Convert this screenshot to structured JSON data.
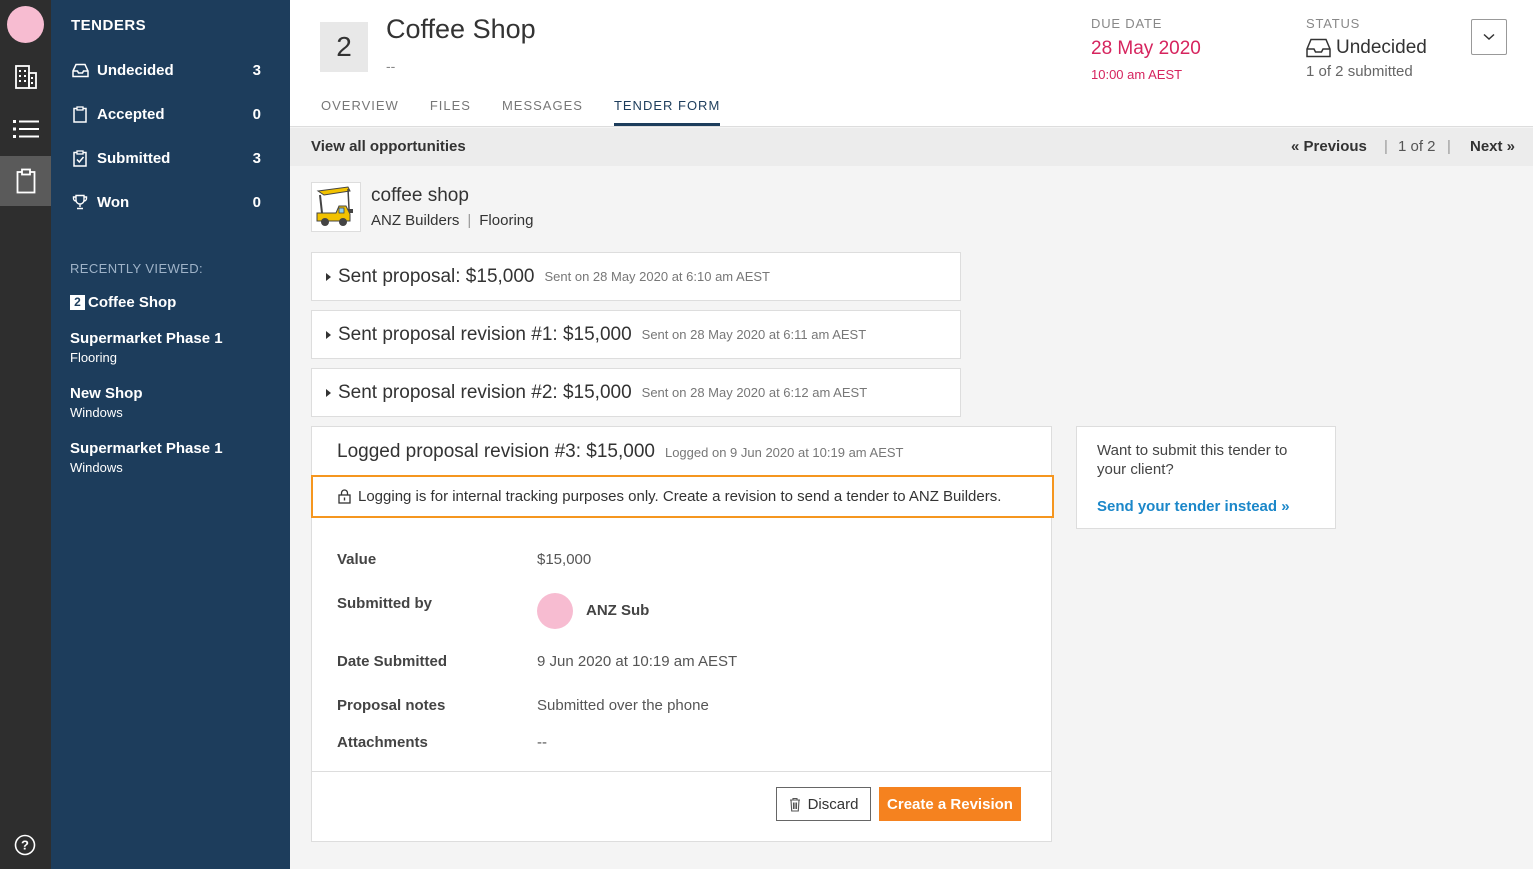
{
  "rail": {
    "icons": [
      "building-icon",
      "list-icon",
      "clipboard-icon",
      "help-icon"
    ]
  },
  "sidebar": {
    "heading": "TENDERS",
    "items": [
      {
        "label": "Undecided",
        "count": "3",
        "icon": "inbox-icon"
      },
      {
        "label": "Accepted",
        "count": "0",
        "icon": "clipboard-icon"
      },
      {
        "label": "Submitted",
        "count": "3",
        "icon": "clipboard-check-icon"
      },
      {
        "label": "Won",
        "count": "0",
        "icon": "trophy-icon"
      }
    ],
    "recent_heading": "RECENTLY VIEWED:",
    "recent": [
      {
        "badge": "2",
        "title": "Coffee Shop",
        "sub": ""
      },
      {
        "title": "Supermarket Phase 1",
        "sub": "Flooring"
      },
      {
        "title": "New Shop",
        "sub": "Windows"
      },
      {
        "title": "Supermarket Phase 1",
        "sub": "Windows"
      }
    ]
  },
  "header": {
    "number": "2",
    "title": "Coffee Shop",
    "subtitle": "--",
    "tabs": [
      "OVERVIEW",
      "FILES",
      "MESSAGES",
      "TENDER FORM"
    ],
    "active_tab": "TENDER FORM",
    "due_label": "DUE DATE",
    "due_date": "28 May 2020",
    "due_time": "10:00 am AEST",
    "status_label": "STATUS",
    "status_value": "Undecided",
    "status_sub": "1 of 2 submitted"
  },
  "bar": {
    "view_all": "View all opportunities",
    "previous": "« Previous",
    "position": "1 of 2",
    "next": "Next »"
  },
  "project": {
    "title": "coffee shop",
    "client": "ANZ Builders",
    "trade": "Flooring"
  },
  "proposals": [
    {
      "title": "Sent proposal: $15,000",
      "meta": "Sent on 28 May 2020 at 6:10 am AEST"
    },
    {
      "title": "Sent proposal revision #1: $15,000",
      "meta": "Sent on 28 May 2020 at 6:11 am AEST"
    },
    {
      "title": "Sent proposal revision #2: $15,000",
      "meta": "Sent on 28 May 2020 at 6:12 am AEST"
    }
  ],
  "logged": {
    "title": "Logged proposal revision #3: $15,000",
    "meta": "Logged on 9 Jun 2020 at 10:19 am AEST",
    "notice": "Logging is for internal tracking purposes only. Create a revision to send a tender to ANZ Builders.",
    "fields": {
      "value_label": "Value",
      "value": "$15,000",
      "submitted_by_label": "Submitted by",
      "submitted_by": "ANZ Sub",
      "date_label": "Date Submitted",
      "date": "9 Jun 2020 at 10:19 am AEST",
      "notes_label": "Proposal notes",
      "notes": "Submitted over the phone",
      "attachments_label": "Attachments",
      "attachments": "--"
    },
    "discard_label": "Discard",
    "create_label": "Create a Revision"
  },
  "side_card": {
    "question": "Want to submit this tender to your client?",
    "link": "Send your tender instead »"
  },
  "colors": {
    "sidebar": "#1d3d5c",
    "rail": "#2e2e2e",
    "due": "#d6245e",
    "accent": "#f5821f",
    "link": "#1b87c9",
    "highlight": "#f5961f",
    "avatar": "#f7bcd1"
  }
}
